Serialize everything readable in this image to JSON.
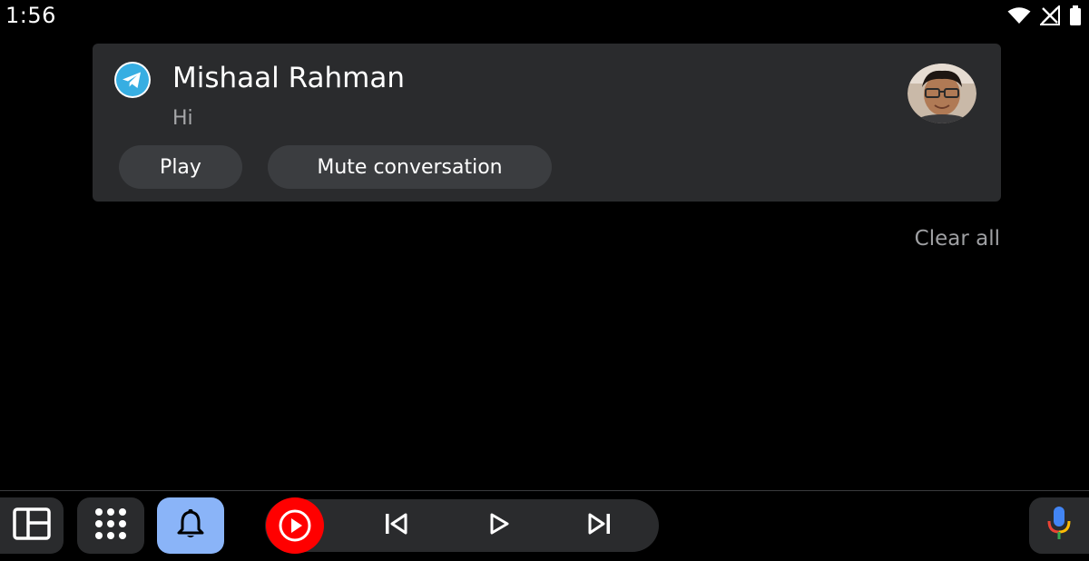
{
  "status_bar": {
    "time": "1:56",
    "icons": [
      "wifi-icon",
      "no-signal-icon",
      "battery-icon"
    ]
  },
  "notification": {
    "app_icon": "telegram-icon",
    "sender": "Mishaal Rahman",
    "message": "Hi",
    "avatar": "contact-avatar",
    "actions": {
      "play_label": "Play",
      "mute_label": "Mute conversation"
    }
  },
  "clear_all_label": "Clear all",
  "dock": {
    "icons": [
      "layout-icon",
      "app-grid-icon",
      "bell-icon",
      "youtube-music-icon",
      "skip-previous-icon",
      "play-icon",
      "skip-next-icon",
      "microphone-icon"
    ]
  },
  "colors": {
    "card_bg": "#2a2b2d",
    "button_bg": "#3b3d40",
    "notif_active": "#8ab4f8",
    "youtube_red": "#ff0000",
    "telegram_blue": "#37aee2"
  }
}
